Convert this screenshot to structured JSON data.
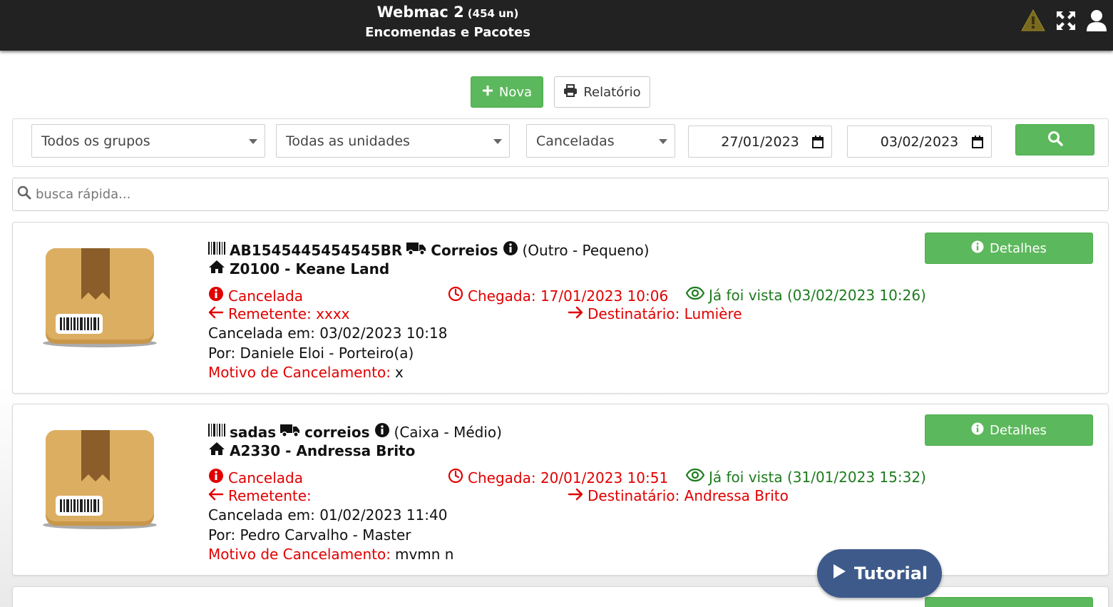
{
  "header": {
    "app_name": "Webmac 2",
    "app_count": "(454 un)",
    "subtitle": "Encomendas e Pacotes",
    "icons": [
      "warning-icon",
      "expand-icon",
      "user-icon"
    ]
  },
  "actions": {
    "new_label": "Nova",
    "report_label": "Relatório"
  },
  "filters": {
    "group": "Todos os grupos",
    "unit": "Todas as unidades",
    "status": "Canceladas",
    "date_from": "27/01/2023",
    "date_to": "03/02/2023"
  },
  "search": {
    "placeholder": "busca rápida..."
  },
  "packages": [
    {
      "code": "AB1545445454545BR",
      "carrier": "Correios",
      "type": "(Outro - Pequeno)",
      "unit": "Z0100 - Keane Land",
      "status": "Cancelada",
      "arrival": "Chegada: 17/01/2023 10:06",
      "seen": "Já foi vista (03/02/2023 10:26)",
      "sender": "Remetente: xxxx",
      "recipient": "Destinatário: Lumière",
      "cancelled_at": "Cancelada em: 03/02/2023 10:18",
      "by": "Por: Daniele Eloi - Porteiro(a)",
      "reason_label": "Motivo de Cancelamento:",
      "reason": "x",
      "details_label": "Detalhes"
    },
    {
      "code": "sadas",
      "carrier": "correios",
      "type": "(Caixa - Médio)",
      "unit": "A2330 - Andressa Brito",
      "status": "Cancelada",
      "arrival": "Chegada: 20/01/2023 10:51",
      "seen": "Já foi vista (31/01/2023 15:32)",
      "sender": "Remetente:",
      "recipient": "Destinatário: Andressa Brito",
      "cancelled_at": "Cancelada em: 01/02/2023 11:40",
      "by": "Por: Pedro Carvalho - Master",
      "reason_label": "Motivo de Cancelamento:",
      "reason": "mvmn n",
      "details_label": "Detalhes"
    }
  ],
  "tutorial_label": "Tutorial",
  "colors": {
    "header_bg": "#222222",
    "primary_green": "#5cb85c",
    "danger_red": "#e10000",
    "seen_green": "#1d7b1d",
    "tutorial_blue": "#3d5a8a"
  }
}
